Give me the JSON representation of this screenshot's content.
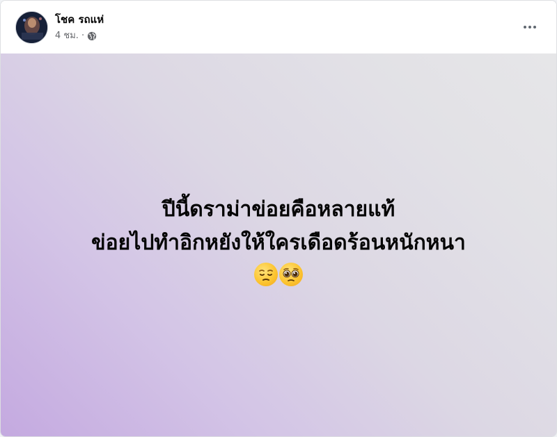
{
  "post": {
    "author": "โชค รถแห่",
    "time": "4 ชม.",
    "separator": "·",
    "privacy_icon": "globe-icon",
    "more_icon": "more-options-icon",
    "text_line1": "ปีนี้ดราม่าข่อยคือหลายแท้",
    "text_line2": "ข่อยไปทำอิกหยังให้ใครเดือดร้อนหนักหนา",
    "emojis": [
      "pensive-face-icon",
      "pleading-face-icon"
    ],
    "background_colors": [
      "#c4a9e0",
      "#e6e6e8"
    ]
  }
}
